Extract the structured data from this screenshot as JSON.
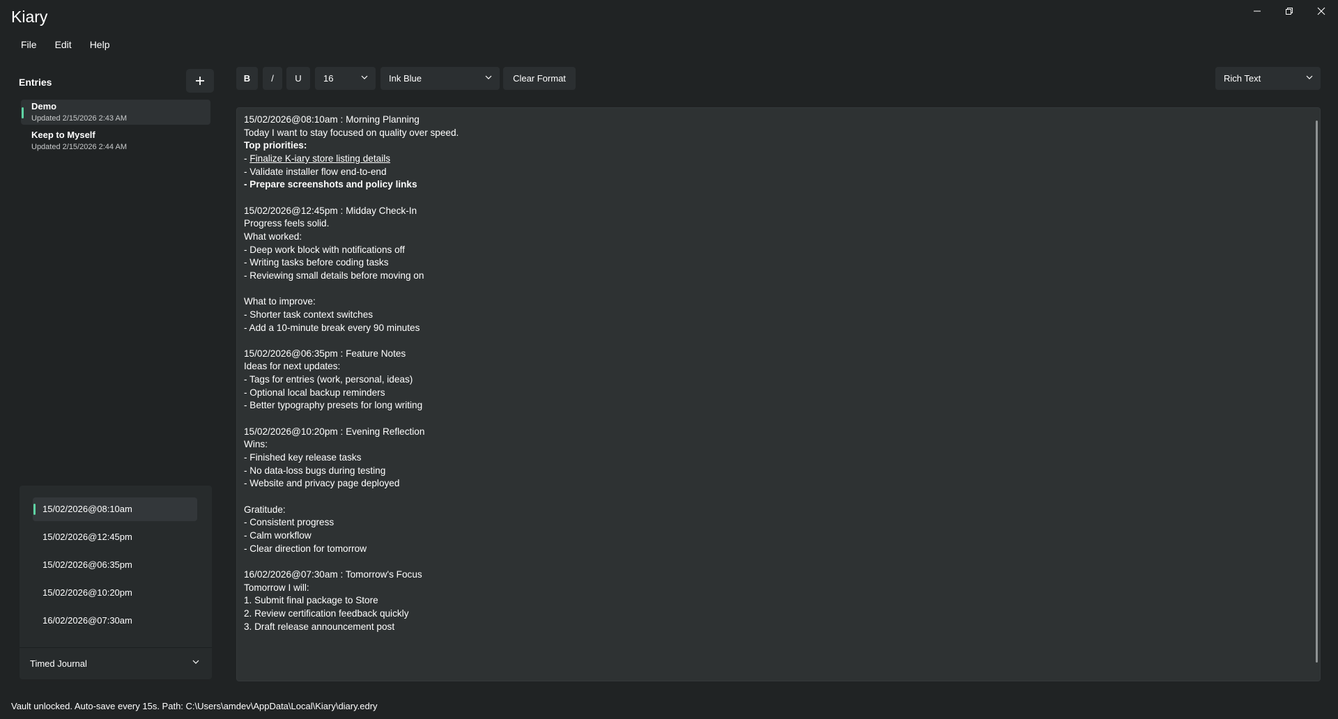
{
  "window": {
    "title": "Kiary",
    "controls": [
      "minimize-icon",
      "restore-icon",
      "close-icon"
    ]
  },
  "menu": {
    "items": [
      "File",
      "Edit",
      "Help"
    ]
  },
  "sidebar": {
    "header": "Entries",
    "add_icon": "plus-icon",
    "entries": [
      {
        "name": "Demo",
        "updated": "Updated 2/15/2026 2:43 AM",
        "selected": true
      },
      {
        "name": "Keep to Myself",
        "updated": "Updated 2/15/2026 2:44 AM",
        "selected": false
      }
    ],
    "timestamps": [
      {
        "label": "15/02/2026@08:10am",
        "selected": true
      },
      {
        "label": "15/02/2026@12:45pm",
        "selected": false
      },
      {
        "label": "15/02/2026@06:35pm",
        "selected": false
      },
      {
        "label": "15/02/2026@10:20pm",
        "selected": false
      },
      {
        "label": "16/02/2026@07:30am",
        "selected": false
      }
    ],
    "mode": "Timed Journal",
    "accent_color": "#5ed3a3"
  },
  "toolbar": {
    "bold": "B",
    "italic": "/",
    "underline": "U",
    "font_size": "16",
    "color": "Ink Blue",
    "clear": "Clear Format",
    "format_mode": "Rich Text"
  },
  "editor": {
    "lines": [
      {
        "text": "15/02/2026@08:10am : Morning Planning"
      },
      {
        "text": "Today I want to stay focused on quality over speed."
      },
      {
        "text": "Top priorities:",
        "bold": true
      },
      {
        "prefix": "- ",
        "text": "Finalize K-iary store listing details",
        "underline": true
      },
      {
        "text": "- Validate installer flow end-to-end"
      },
      {
        "text": "- Prepare screenshots and policy links",
        "bold": true
      },
      {
        "text": ""
      },
      {
        "text": "15/02/2026@12:45pm : Midday Check-In"
      },
      {
        "text": "Progress feels solid."
      },
      {
        "text": "What worked:"
      },
      {
        "text": "- Deep work block with notifications off"
      },
      {
        "text": "- Writing tasks before coding tasks"
      },
      {
        "text": "- Reviewing small details before moving on"
      },
      {
        "text": ""
      },
      {
        "text": "What to improve:"
      },
      {
        "text": "- Shorter task context switches"
      },
      {
        "text": "- Add a 10-minute break every 90 minutes"
      },
      {
        "text": ""
      },
      {
        "text": "15/02/2026@06:35pm : Feature Notes"
      },
      {
        "text": "Ideas for next updates:"
      },
      {
        "text": "- Tags for entries (work, personal, ideas)"
      },
      {
        "text": "- Optional local backup reminders"
      },
      {
        "text": "- Better typography presets for long writing"
      },
      {
        "text": ""
      },
      {
        "text": "15/02/2026@10:20pm : Evening Reflection"
      },
      {
        "text": "Wins:"
      },
      {
        "text": "- Finished key release tasks"
      },
      {
        "text": "- No data-loss bugs during testing"
      },
      {
        "text": "- Website and privacy page deployed"
      },
      {
        "text": ""
      },
      {
        "text": "Gratitude:"
      },
      {
        "text": "- Consistent progress"
      },
      {
        "text": "- Calm workflow"
      },
      {
        "text": "- Clear direction for tomorrow"
      },
      {
        "text": ""
      },
      {
        "text": "16/02/2026@07:30am : Tomorrow's Focus"
      },
      {
        "text": "Tomorrow I will:"
      },
      {
        "text": "1. Submit final package to Store"
      },
      {
        "text": "2. Review certification feedback quickly"
      },
      {
        "text": "3. Draft release announcement post"
      }
    ]
  },
  "status": "Vault unlocked. Auto-save every 15s. Path: C:\\Users\\amdev\\AppData\\Local\\Kiary\\diary.edry"
}
